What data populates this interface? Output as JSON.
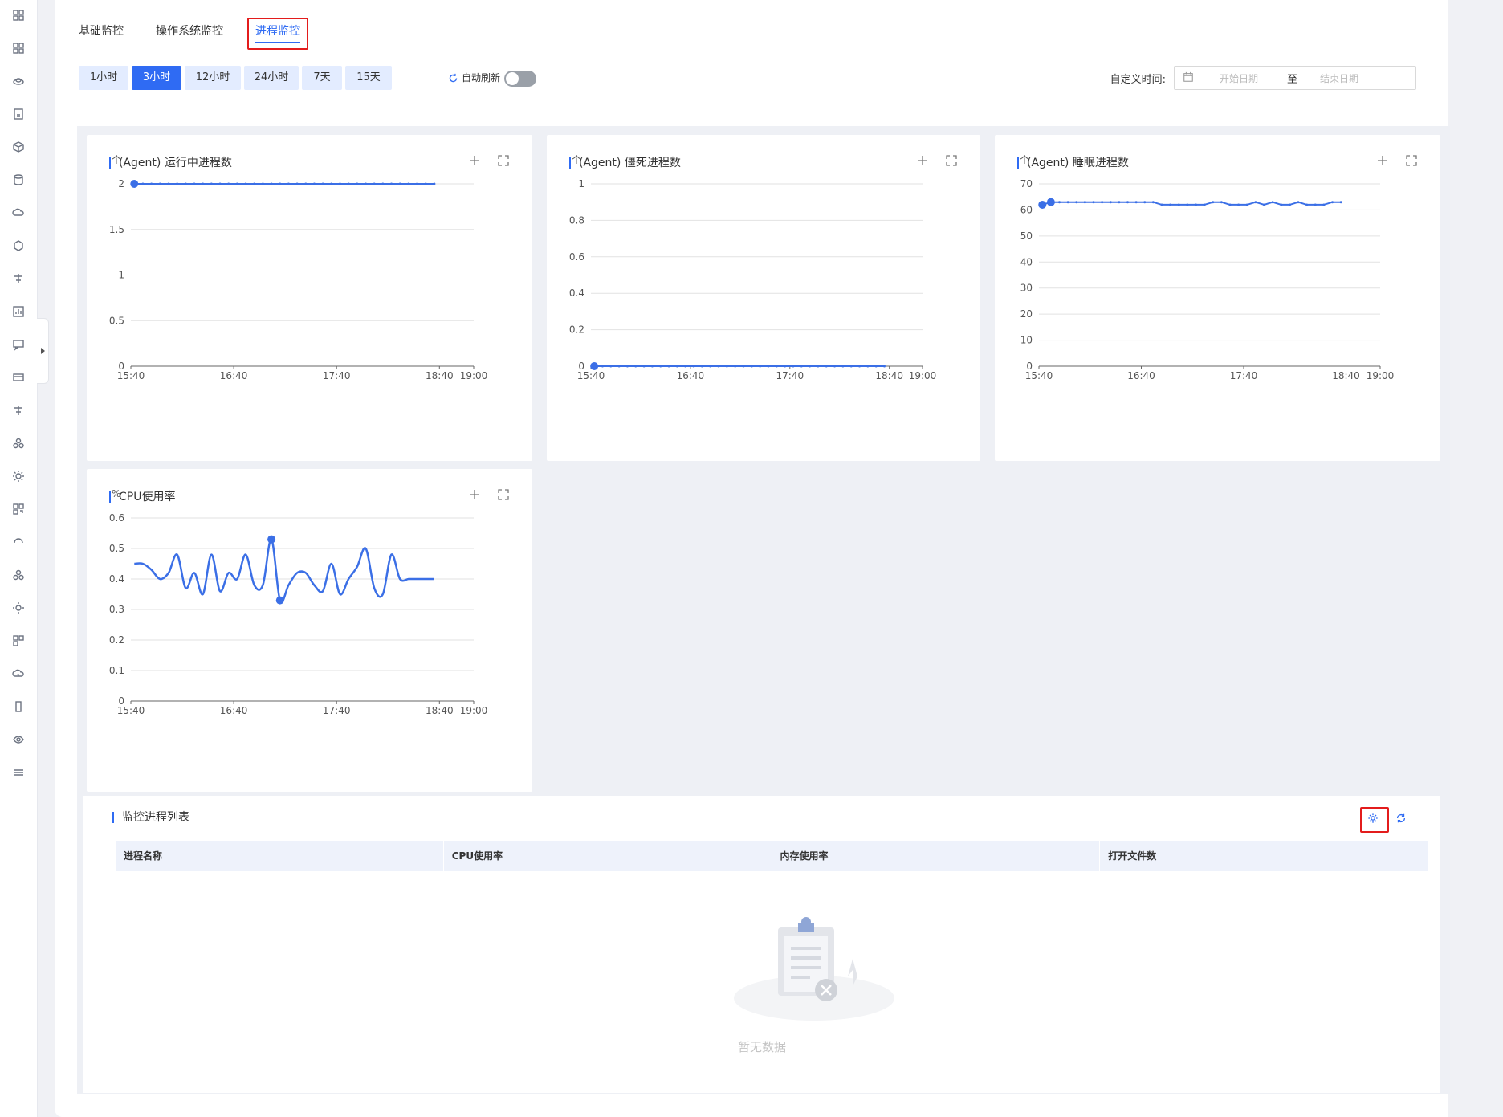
{
  "tabs": [
    {
      "label": "基础监控",
      "active": false
    },
    {
      "label": "操作系统监控",
      "active": false
    },
    {
      "label": "进程监控",
      "active": true
    }
  ],
  "time_ranges": [
    {
      "label": "1小时",
      "active": false
    },
    {
      "label": "3小时",
      "active": true
    },
    {
      "label": "12小时",
      "active": false
    },
    {
      "label": "24小时",
      "active": false
    },
    {
      "label": "7天",
      "active": false
    },
    {
      "label": "15天",
      "active": false
    }
  ],
  "auto_refresh": {
    "label": "自动刷新",
    "on": false
  },
  "custom_time": {
    "label": "自定义时间:",
    "start_placeholder": "开始日期",
    "separator": "至",
    "end_placeholder": "结束日期"
  },
  "colors": {
    "accent": "#2f6bf3",
    "highlight": "#e31c1c",
    "series": "#3b6fe6"
  },
  "chart_data": [
    {
      "type": "line",
      "title": "(Agent) 运行中进程数",
      "ylabel": "个",
      "yticks": [
        "0",
        "0.5",
        "1",
        "1.5",
        "2"
      ],
      "ylim": [
        0,
        2
      ],
      "xticks": [
        "15:40",
        "16:40",
        "17:40",
        "18:40",
        "19:00"
      ],
      "x": [
        "15:42",
        "15:47",
        "15:52",
        "15:57",
        "16:02",
        "16:07",
        "16:12",
        "16:17",
        "16:22",
        "16:27",
        "16:32",
        "16:37",
        "16:42",
        "16:47",
        "16:52",
        "16:57",
        "17:02",
        "17:07",
        "17:12",
        "17:17",
        "17:22",
        "17:27",
        "17:32",
        "17:37",
        "17:42",
        "17:47",
        "17:52",
        "17:57",
        "18:02",
        "18:07",
        "18:12",
        "18:17",
        "18:22",
        "18:27",
        "18:32",
        "18:37"
      ],
      "series": [
        {
          "values": [
            2,
            2,
            2,
            2,
            2,
            2,
            2,
            2,
            2,
            2,
            2,
            2,
            2,
            2,
            2,
            2,
            2,
            2,
            2,
            2,
            2,
            2,
            2,
            2,
            2,
            2,
            2,
            2,
            2,
            2,
            2,
            2,
            2,
            2,
            2,
            2
          ]
        }
      ]
    },
    {
      "type": "line",
      "title": "(Agent) 僵死进程数",
      "ylabel": "个",
      "yticks": [
        "0",
        "0.2",
        "0.4",
        "0.6",
        "0.8",
        "1"
      ],
      "ylim": [
        0,
        1
      ],
      "xticks": [
        "15:40",
        "16:40",
        "17:40",
        "18:40",
        "19:00"
      ],
      "x": [
        "15:42",
        "15:47",
        "15:52",
        "15:57",
        "16:02",
        "16:07",
        "16:12",
        "16:17",
        "16:22",
        "16:27",
        "16:32",
        "16:37",
        "16:42",
        "16:47",
        "16:52",
        "16:57",
        "17:02",
        "17:07",
        "17:12",
        "17:17",
        "17:22",
        "17:27",
        "17:32",
        "17:37",
        "17:42",
        "17:47",
        "17:52",
        "17:57",
        "18:02",
        "18:07",
        "18:12",
        "18:17",
        "18:22",
        "18:27",
        "18:32",
        "18:37"
      ],
      "series": [
        {
          "values": [
            0,
            0,
            0,
            0,
            0,
            0,
            0,
            0,
            0,
            0,
            0,
            0,
            0,
            0,
            0,
            0,
            0,
            0,
            0,
            0,
            0,
            0,
            0,
            0,
            0,
            0,
            0,
            0,
            0,
            0,
            0,
            0,
            0,
            0,
            0,
            0
          ]
        }
      ]
    },
    {
      "type": "line",
      "title": "(Agent) 睡眠进程数",
      "ylabel": "个",
      "yticks": [
        "0",
        "10",
        "20",
        "30",
        "40",
        "50",
        "60",
        "70"
      ],
      "ylim": [
        0,
        70
      ],
      "xticks": [
        "15:40",
        "16:40",
        "17:40",
        "18:40",
        "19:00"
      ],
      "x": [
        "15:42",
        "15:47",
        "15:52",
        "15:57",
        "16:02",
        "16:07",
        "16:12",
        "16:17",
        "16:22",
        "16:27",
        "16:32",
        "16:37",
        "16:42",
        "16:47",
        "16:52",
        "16:57",
        "17:02",
        "17:07",
        "17:12",
        "17:17",
        "17:22",
        "17:27",
        "17:32",
        "17:37",
        "17:42",
        "17:47",
        "17:52",
        "17:57",
        "18:02",
        "18:07",
        "18:12",
        "18:17",
        "18:22",
        "18:27",
        "18:32",
        "18:37"
      ],
      "series": [
        {
          "values": [
            62,
            63,
            63,
            63,
            63,
            63,
            63,
            63,
            63,
            63,
            63,
            63,
            63,
            63,
            62,
            62,
            62,
            62,
            62,
            62,
            63,
            63,
            62,
            62,
            62,
            63,
            62,
            63,
            62,
            62,
            63,
            62,
            62,
            62,
            63,
            63
          ]
        }
      ]
    },
    {
      "type": "line",
      "title": "CPU使用率",
      "ylabel": "%",
      "yticks": [
        "0",
        "0.1",
        "0.2",
        "0.3",
        "0.4",
        "0.5",
        "0.6"
      ],
      "ylim": [
        0,
        0.6
      ],
      "xticks": [
        "15:40",
        "16:40",
        "17:40",
        "18:40",
        "19:00"
      ],
      "x": [
        "15:42",
        "15:47",
        "15:52",
        "15:57",
        "16:02",
        "16:07",
        "16:12",
        "16:17",
        "16:22",
        "16:27",
        "16:32",
        "16:37",
        "16:42",
        "16:47",
        "16:52",
        "16:57",
        "17:02",
        "17:07",
        "17:12",
        "17:17",
        "17:22",
        "17:27",
        "17:32",
        "17:37",
        "17:42",
        "17:47",
        "17:52",
        "17:57",
        "18:02",
        "18:07",
        "18:12",
        "18:17",
        "18:22",
        "18:27",
        "18:32",
        "18:37"
      ],
      "series": [
        {
          "values": [
            0.45,
            0.45,
            0.43,
            0.4,
            0.42,
            0.48,
            0.37,
            0.42,
            0.35,
            0.48,
            0.36,
            0.42,
            0.4,
            0.48,
            0.38,
            0.38,
            0.53,
            0.33,
            0.38,
            0.42,
            0.42,
            0.38,
            0.36,
            0.45,
            0.35,
            0.4,
            0.44,
            0.5,
            0.37,
            0.35,
            0.48,
            0.4,
            0.4,
            0.4,
            0.4,
            0.4
          ]
        }
      ]
    }
  ],
  "process_list": {
    "title": "监控进程列表",
    "columns": [
      "进程名称",
      "CPU使用率",
      "内存使用率",
      "打开文件数"
    ],
    "empty_text": "暂无数据"
  },
  "icons": {
    "settings": "gear-icon",
    "refresh": "refresh-icon",
    "add": "plus-icon",
    "expand": "fullscreen-icon",
    "calendar": "calendar-icon"
  }
}
